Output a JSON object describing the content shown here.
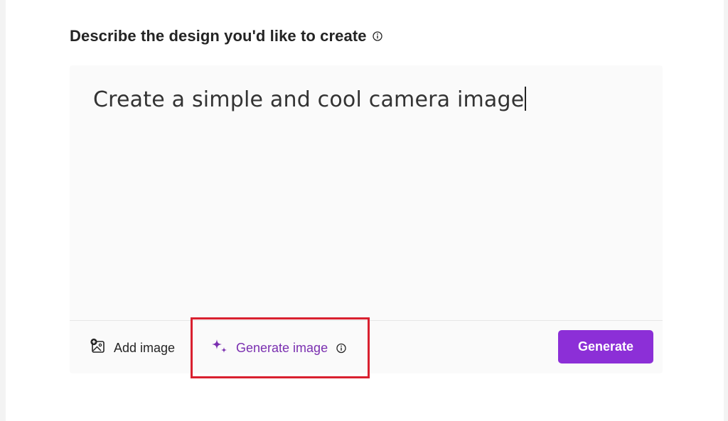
{
  "heading": {
    "text": "Describe the design you'd like to create",
    "info_icon": "info-icon"
  },
  "prompt": {
    "value": "Create a simple and cool camera image"
  },
  "toolbar": {
    "add_image_label": "Add image",
    "add_image_icon": "image-add-icon",
    "generate_image_label": "Generate image",
    "generate_image_icon": "sparkle-icon",
    "generate_image_info_icon": "info-icon",
    "generate_button_label": "Generate"
  },
  "colors": {
    "accent": "#8c2fd7",
    "accent_text": "#7a2fb0",
    "highlight": "#d9202f",
    "card_bg": "#fafafa"
  }
}
